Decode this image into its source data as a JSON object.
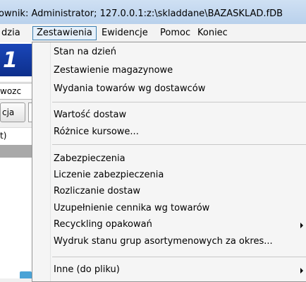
{
  "window": {
    "title": "ownik: Administrator; 127.0.0.1:z:\\skladdane\\BAZASKLAD.fDB"
  },
  "menubar": {
    "items": [
      {
        "label": "dzia"
      },
      {
        "label": "Zestawienia",
        "active": true
      },
      {
        "label": "Ewidencje"
      },
      {
        "label": "Pomoc"
      },
      {
        "label": "Koniec"
      }
    ]
  },
  "background": {
    "logo_text": "1",
    "field_text": "wozc",
    "button_text": "cja",
    "label_text": "t)"
  },
  "dropdown": {
    "groups": [
      {
        "items": [
          {
            "label": "Stan na dzień",
            "submenu": false
          },
          {
            "label": "Zestawienie magazynowe",
            "submenu": false
          },
          {
            "label": "Wydania towarów wg dostawców",
            "submenu": false
          }
        ]
      },
      {
        "items": [
          {
            "label": "Wartość dostaw",
            "submenu": false
          },
          {
            "label": "Różnice kursowe...",
            "submenu": false
          }
        ]
      },
      {
        "items": [
          {
            "label": "Zabezpieczenia",
            "submenu": false
          },
          {
            "label": "Liczenie zabezpieczenia",
            "submenu": false
          },
          {
            "label": "Rozliczanie dostaw",
            "submenu": false
          },
          {
            "label": "Uzupełnienie cennika wg towarów",
            "submenu": false
          },
          {
            "label": "Recyckling opakowań",
            "submenu": true
          },
          {
            "label": "Wydruk stanu grup asortymenowych za okres...",
            "submenu": false
          }
        ]
      },
      {
        "items": [
          {
            "label": "Inne (do pliku)",
            "submenu": true
          }
        ]
      }
    ]
  }
}
